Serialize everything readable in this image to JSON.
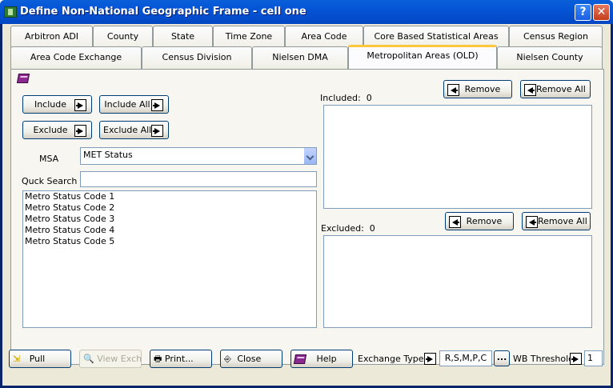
{
  "window": {
    "title": "Define Non-National Geographic Frame - cell one",
    "help_glyph": "?",
    "close_glyph": "✕"
  },
  "tabs_row1": [
    "Arbitron ADI",
    "County",
    "State",
    "Time Zone",
    "Area Code",
    "Core Based Statistical Areas",
    "Census Region"
  ],
  "tabs_row2": [
    "Area Code Exchange",
    "Census Division",
    "Nielsen DMA",
    "Metropolitan Areas (OLD)",
    "Nielsen County"
  ],
  "active_tab": "Metropolitan Areas (OLD)",
  "left": {
    "include_label": "Include",
    "include_all_label": "Include All",
    "exclude_label": "Exclude",
    "exclude_all_label": "Exclude All",
    "msa_label": "MSA",
    "msa_value": "MET Status",
    "quick_search_label": "Quck Search",
    "quick_search_value": "",
    "list_items": [
      "Metro Status Code 1",
      "Metro Status Code 2",
      "Metro Status Code 3",
      "Metro Status Code 4",
      "Metro Status Code 5"
    ]
  },
  "right": {
    "included_label": "Included:",
    "included_count": "0",
    "excluded_label": "Excluded:",
    "excluded_count": "0",
    "remove_label": "Remove",
    "remove_all_label": "Remove All"
  },
  "bottom": {
    "pull_label": "Pull",
    "view_exch_label": "View Exch",
    "print_label": "Print...",
    "close_label": "Close",
    "help_label": "Help",
    "exchange_types_label": "Exchange Types",
    "exchange_types_value": "R,S,M,P,C",
    "ellipsis_label": "...",
    "wb_threshold_label": "WB Threshold",
    "wb_threshold_value": "1"
  },
  "colors": {
    "titlebar": "#0454d6",
    "tab_highlight": "#ffc73c",
    "dialog_bg": "#ece9d8"
  }
}
